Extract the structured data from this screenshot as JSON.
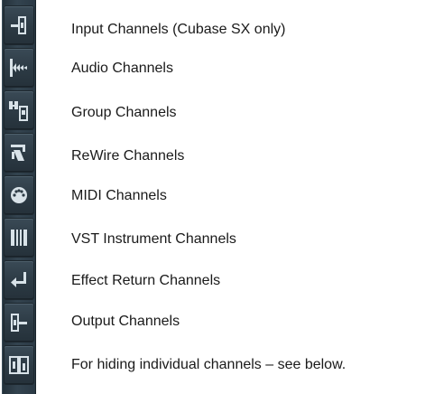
{
  "channel_filter": {
    "items": [
      {
        "icon": "input-channel-icon",
        "label": "Input Channels (Cubase SX only)"
      },
      {
        "icon": "audio-channel-icon",
        "label": "Audio Channels"
      },
      {
        "icon": "group-channel-icon",
        "label": "Group Channels"
      },
      {
        "icon": "rewire-channel-icon",
        "label": "ReWire Channels"
      },
      {
        "icon": "midi-channel-icon",
        "label": "MIDI Channels"
      },
      {
        "icon": "vst-instrument-channel-icon",
        "label": "VST Instrument Channels"
      },
      {
        "icon": "effect-return-channel-icon",
        "label": "Effect Return Channels"
      },
      {
        "icon": "output-channel-icon",
        "label": "Output Channels"
      },
      {
        "icon": "hide-channels-icon",
        "label": "For hiding individual channels – see below."
      }
    ]
  },
  "colors": {
    "strip_background": "#2a3a45",
    "icon_foreground": "#d8e2e8",
    "text": "#1a1a1a"
  }
}
